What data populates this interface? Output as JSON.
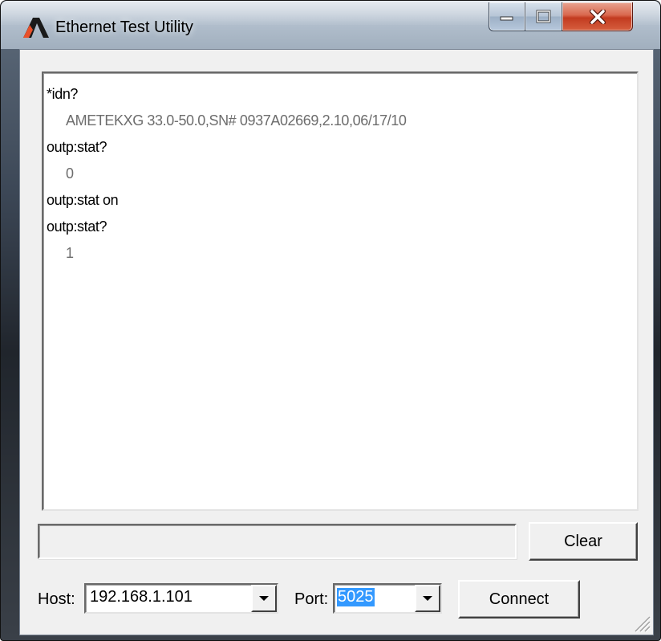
{
  "window": {
    "title": "Ethernet Test Utility",
    "icon": "ametek-logo-icon",
    "controls": [
      "minimize-icon",
      "maximize-icon",
      "close-icon"
    ]
  },
  "console": {
    "lines": [
      {
        "type": "command",
        "text": "*idn?"
      },
      {
        "type": "response",
        "text": "AMETEKXG 33.0-50.0,SN# 0937A02669,2.10,06/17/10"
      },
      {
        "type": "command",
        "text": "outp:stat?"
      },
      {
        "type": "response",
        "text": "0"
      },
      {
        "type": "command",
        "text": "outp:stat on"
      },
      {
        "type": "command",
        "text": "outp:stat?"
      },
      {
        "type": "response",
        "text": "1"
      }
    ]
  },
  "command_input": {
    "value": ""
  },
  "buttons": {
    "clear": "Clear",
    "connect": "Connect"
  },
  "host": {
    "label": "Host:",
    "value": "192.168.1.101"
  },
  "port": {
    "label": "Port:",
    "value": "5025"
  },
  "colors": {
    "response_text": "#6d6d6d",
    "selection": "#3399ff",
    "close_button": "#c8452a",
    "logo_orange": "#e8502a"
  }
}
